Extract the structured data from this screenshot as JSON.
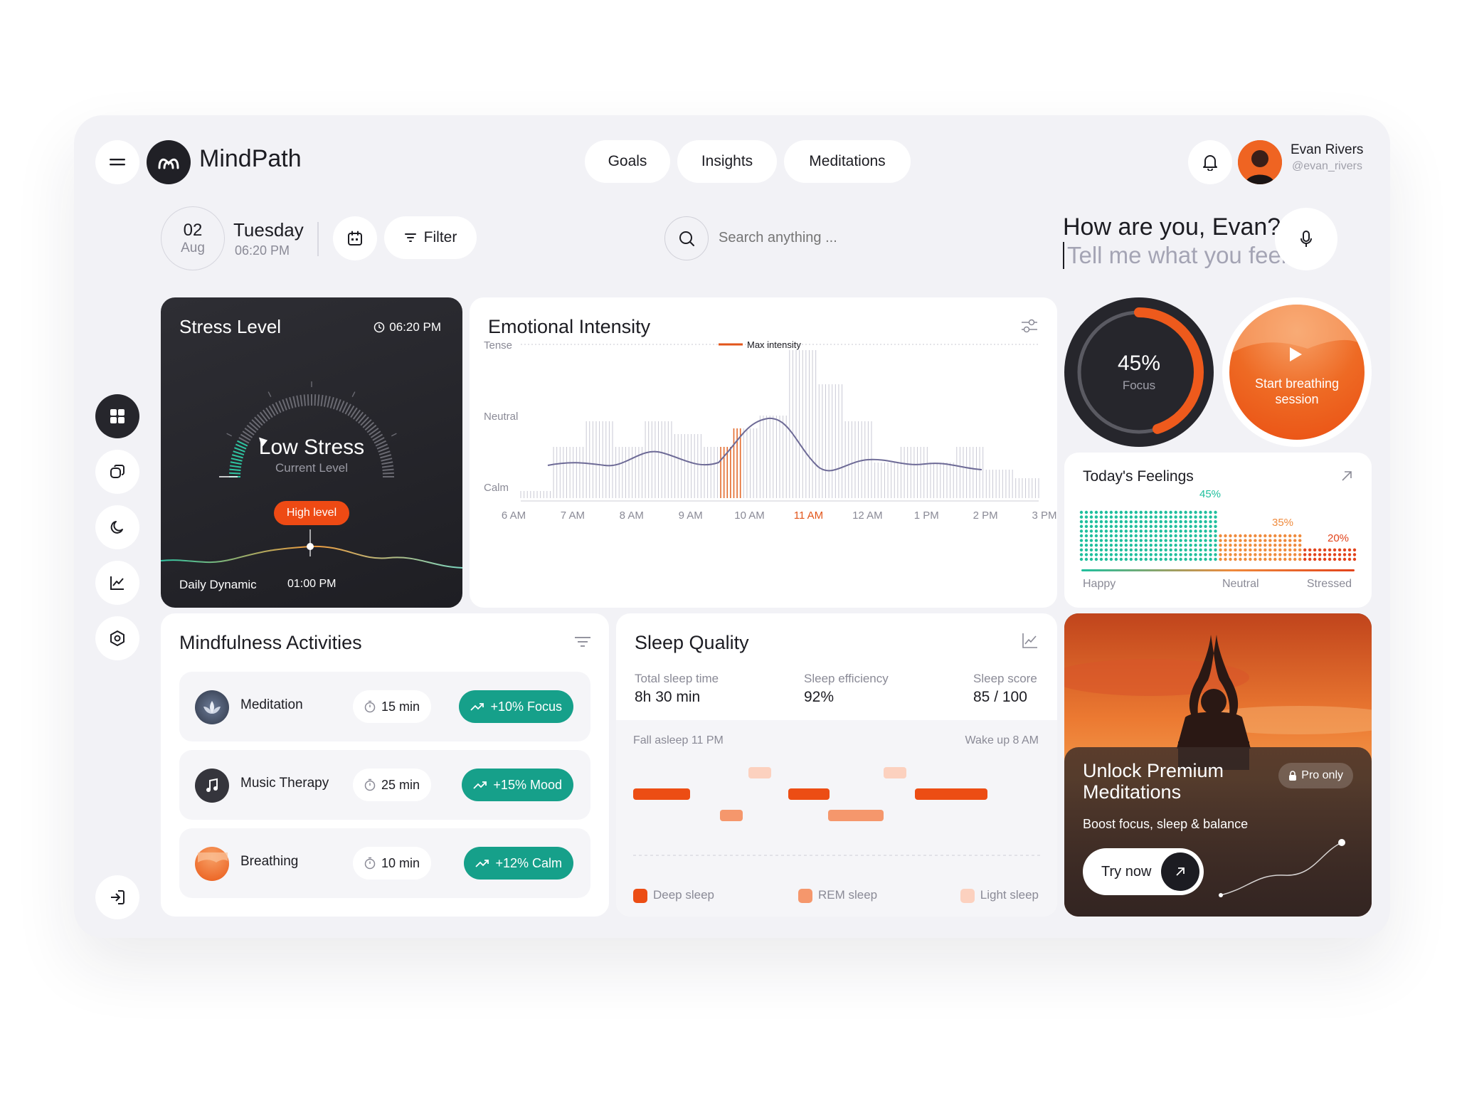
{
  "app": {
    "name": "MindPath"
  },
  "nav": {
    "goals": "Goals",
    "insights": "Insights",
    "meditations": "Meditations"
  },
  "user": {
    "name": "Evan Rivers",
    "handle": "@evan_rivers"
  },
  "date": {
    "day": "02",
    "month": "Aug",
    "weekday": "Tuesday",
    "time": "06:20 PM"
  },
  "toolbar": {
    "filter_label": "Filter"
  },
  "search": {
    "placeholder": "Search anything ..."
  },
  "greeting": {
    "title": "How are you, Evan?",
    "prompt": "Tell me what you feel"
  },
  "stress": {
    "title": "Stress Level",
    "time": "06:20 PM",
    "status": "Low Stress",
    "status_sub": "Current Level",
    "badge": "High level",
    "footer_label": "Daily Dynamic",
    "footer_time": "01:00 PM",
    "level": 0.15
  },
  "emotional": {
    "title": "Emotional Intensity",
    "y_labels": [
      "Tense",
      "Neutral",
      "Calm"
    ],
    "max_label": "Max intensity",
    "x_labels": [
      "6 AM",
      "7 AM",
      "8 AM",
      "9 AM",
      "10 AM",
      "11 AM",
      "12 AM",
      "1 PM",
      "2 PM",
      "3 PM"
    ],
    "active_x": "11 AM"
  },
  "focus": {
    "percent": "45%",
    "label": "Focus",
    "value": 0.45
  },
  "breathing": {
    "label": "Start breathing session"
  },
  "feelings": {
    "title": "Today's Feelings",
    "happy": {
      "label": "Happy",
      "value": "45%",
      "color": "#1fbf9d"
    },
    "neutral": {
      "label": "Neutral",
      "value": "35%",
      "color": "#ef8a3c"
    },
    "stressed": {
      "label": "Stressed",
      "value": "20%",
      "color": "#e2431b"
    }
  },
  "mindfulness": {
    "title": "Mindfulness Activities",
    "items": [
      {
        "name": "Meditation",
        "duration": "15 min",
        "effect": "+10% Focus"
      },
      {
        "name": "Music Therapy",
        "duration": "25 min",
        "effect": "+15% Mood"
      },
      {
        "name": "Breathing",
        "duration": "10 min",
        "effect": "+12% Calm"
      }
    ]
  },
  "sleep": {
    "title": "Sleep Quality",
    "stats": [
      {
        "label": "Total sleep time",
        "value": "8h 30 min"
      },
      {
        "label": "Sleep efficiency",
        "value": "92%"
      },
      {
        "label": "Sleep score",
        "value": "85 / 100"
      }
    ],
    "asleep": "Fall asleep 11 PM",
    "wake": "Wake up 8 AM",
    "legend": {
      "deep": "Deep sleep",
      "rem": "REM sleep",
      "light": "Light sleep"
    },
    "colors": {
      "deep": "#ec4d14",
      "rem": "#f5976c",
      "light": "#fcd1bf"
    }
  },
  "premium": {
    "title_line1": "Unlock Premium",
    "title_line2": "Meditations",
    "badge": "Pro only",
    "subtitle": "Boost focus, sleep & balance",
    "cta": "Try now"
  },
  "colors": {
    "accent": "#ee5a1c",
    "teal": "#16a08a",
    "dark": "#26262c"
  }
}
